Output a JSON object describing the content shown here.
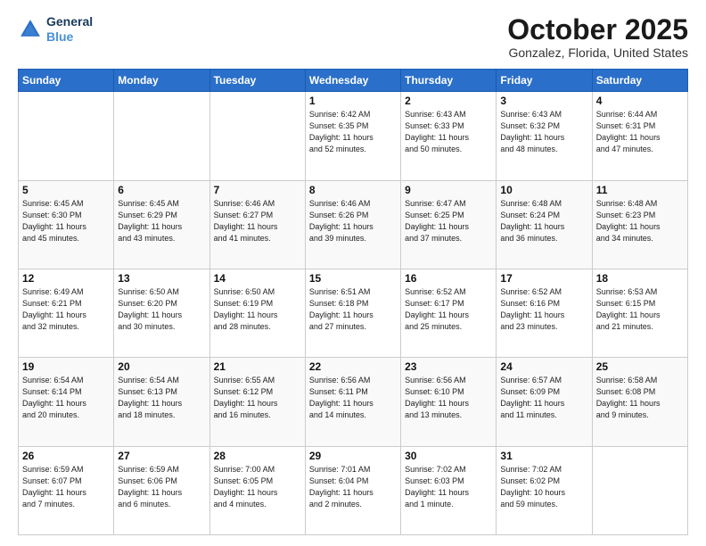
{
  "header": {
    "logo_line1": "General",
    "logo_line2": "Blue",
    "month": "October 2025",
    "location": "Gonzalez, Florida, United States"
  },
  "days_of_week": [
    "Sunday",
    "Monday",
    "Tuesday",
    "Wednesday",
    "Thursday",
    "Friday",
    "Saturday"
  ],
  "weeks": [
    [
      {
        "day": "",
        "content": ""
      },
      {
        "day": "",
        "content": ""
      },
      {
        "day": "",
        "content": ""
      },
      {
        "day": "1",
        "content": "Sunrise: 6:42 AM\nSunset: 6:35 PM\nDaylight: 11 hours\nand 52 minutes."
      },
      {
        "day": "2",
        "content": "Sunrise: 6:43 AM\nSunset: 6:33 PM\nDaylight: 11 hours\nand 50 minutes."
      },
      {
        "day": "3",
        "content": "Sunrise: 6:43 AM\nSunset: 6:32 PM\nDaylight: 11 hours\nand 48 minutes."
      },
      {
        "day": "4",
        "content": "Sunrise: 6:44 AM\nSunset: 6:31 PM\nDaylight: 11 hours\nand 47 minutes."
      }
    ],
    [
      {
        "day": "5",
        "content": "Sunrise: 6:45 AM\nSunset: 6:30 PM\nDaylight: 11 hours\nand 45 minutes."
      },
      {
        "day": "6",
        "content": "Sunrise: 6:45 AM\nSunset: 6:29 PM\nDaylight: 11 hours\nand 43 minutes."
      },
      {
        "day": "7",
        "content": "Sunrise: 6:46 AM\nSunset: 6:27 PM\nDaylight: 11 hours\nand 41 minutes."
      },
      {
        "day": "8",
        "content": "Sunrise: 6:46 AM\nSunset: 6:26 PM\nDaylight: 11 hours\nand 39 minutes."
      },
      {
        "day": "9",
        "content": "Sunrise: 6:47 AM\nSunset: 6:25 PM\nDaylight: 11 hours\nand 37 minutes."
      },
      {
        "day": "10",
        "content": "Sunrise: 6:48 AM\nSunset: 6:24 PM\nDaylight: 11 hours\nand 36 minutes."
      },
      {
        "day": "11",
        "content": "Sunrise: 6:48 AM\nSunset: 6:23 PM\nDaylight: 11 hours\nand 34 minutes."
      }
    ],
    [
      {
        "day": "12",
        "content": "Sunrise: 6:49 AM\nSunset: 6:21 PM\nDaylight: 11 hours\nand 32 minutes."
      },
      {
        "day": "13",
        "content": "Sunrise: 6:50 AM\nSunset: 6:20 PM\nDaylight: 11 hours\nand 30 minutes."
      },
      {
        "day": "14",
        "content": "Sunrise: 6:50 AM\nSunset: 6:19 PM\nDaylight: 11 hours\nand 28 minutes."
      },
      {
        "day": "15",
        "content": "Sunrise: 6:51 AM\nSunset: 6:18 PM\nDaylight: 11 hours\nand 27 minutes."
      },
      {
        "day": "16",
        "content": "Sunrise: 6:52 AM\nSunset: 6:17 PM\nDaylight: 11 hours\nand 25 minutes."
      },
      {
        "day": "17",
        "content": "Sunrise: 6:52 AM\nSunset: 6:16 PM\nDaylight: 11 hours\nand 23 minutes."
      },
      {
        "day": "18",
        "content": "Sunrise: 6:53 AM\nSunset: 6:15 PM\nDaylight: 11 hours\nand 21 minutes."
      }
    ],
    [
      {
        "day": "19",
        "content": "Sunrise: 6:54 AM\nSunset: 6:14 PM\nDaylight: 11 hours\nand 20 minutes."
      },
      {
        "day": "20",
        "content": "Sunrise: 6:54 AM\nSunset: 6:13 PM\nDaylight: 11 hours\nand 18 minutes."
      },
      {
        "day": "21",
        "content": "Sunrise: 6:55 AM\nSunset: 6:12 PM\nDaylight: 11 hours\nand 16 minutes."
      },
      {
        "day": "22",
        "content": "Sunrise: 6:56 AM\nSunset: 6:11 PM\nDaylight: 11 hours\nand 14 minutes."
      },
      {
        "day": "23",
        "content": "Sunrise: 6:56 AM\nSunset: 6:10 PM\nDaylight: 11 hours\nand 13 minutes."
      },
      {
        "day": "24",
        "content": "Sunrise: 6:57 AM\nSunset: 6:09 PM\nDaylight: 11 hours\nand 11 minutes."
      },
      {
        "day": "25",
        "content": "Sunrise: 6:58 AM\nSunset: 6:08 PM\nDaylight: 11 hours\nand 9 minutes."
      }
    ],
    [
      {
        "day": "26",
        "content": "Sunrise: 6:59 AM\nSunset: 6:07 PM\nDaylight: 11 hours\nand 7 minutes."
      },
      {
        "day": "27",
        "content": "Sunrise: 6:59 AM\nSunset: 6:06 PM\nDaylight: 11 hours\nand 6 minutes."
      },
      {
        "day": "28",
        "content": "Sunrise: 7:00 AM\nSunset: 6:05 PM\nDaylight: 11 hours\nand 4 minutes."
      },
      {
        "day": "29",
        "content": "Sunrise: 7:01 AM\nSunset: 6:04 PM\nDaylight: 11 hours\nand 2 minutes."
      },
      {
        "day": "30",
        "content": "Sunrise: 7:02 AM\nSunset: 6:03 PM\nDaylight: 11 hours\nand 1 minute."
      },
      {
        "day": "31",
        "content": "Sunrise: 7:02 AM\nSunset: 6:02 PM\nDaylight: 10 hours\nand 59 minutes."
      },
      {
        "day": "",
        "content": ""
      }
    ]
  ]
}
